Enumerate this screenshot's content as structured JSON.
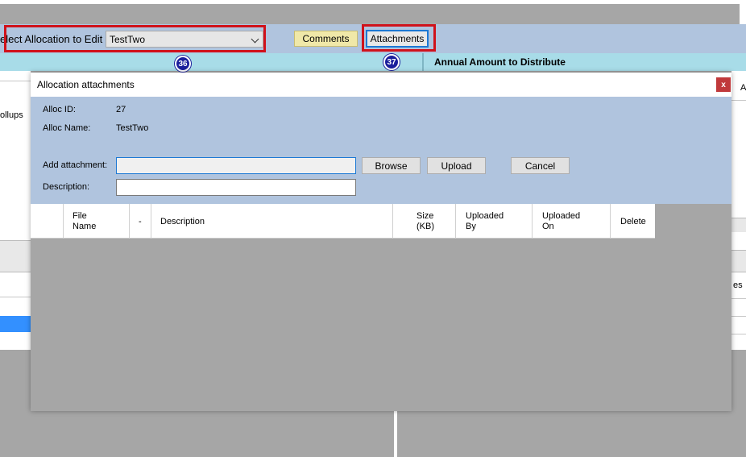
{
  "toolbar": {
    "select_label": "elect Allocation to Edit",
    "select_value": "TestTwo",
    "comments_label": "Comments",
    "attachments_label": "Attachments",
    "badge_select": "36",
    "badge_attachments": "37"
  },
  "band": {
    "annual_label": "Annual Amount to Distribute"
  },
  "background": {
    "left_rollups": "ollups",
    "right_a": "A",
    "right_es": "es"
  },
  "dialog": {
    "title": "Allocation attachments",
    "close_label": "x",
    "alloc_id_label": "Alloc ID:",
    "alloc_id_value": "27",
    "alloc_name_label": "Alloc Name:",
    "alloc_name_value": "TestTwo",
    "add_attachment_label": "Add attachment:",
    "description_label": "Description:",
    "add_attachment_value": "",
    "description_value": "",
    "browse_label": "Browse",
    "upload_label": "Upload",
    "cancel_label": "Cancel",
    "grid": {
      "columns": [
        {
          "line1": "File",
          "line2": "Name"
        },
        {
          "line1": "-",
          "line2": ""
        },
        {
          "line1": "Description",
          "line2": ""
        },
        {
          "line1": "Size",
          "line2": "(KB)"
        },
        {
          "line1": "Uploaded",
          "line2": "By"
        },
        {
          "line1": "Uploaded",
          "line2": "On"
        },
        {
          "line1": "Delete",
          "line2": ""
        }
      ]
    }
  }
}
